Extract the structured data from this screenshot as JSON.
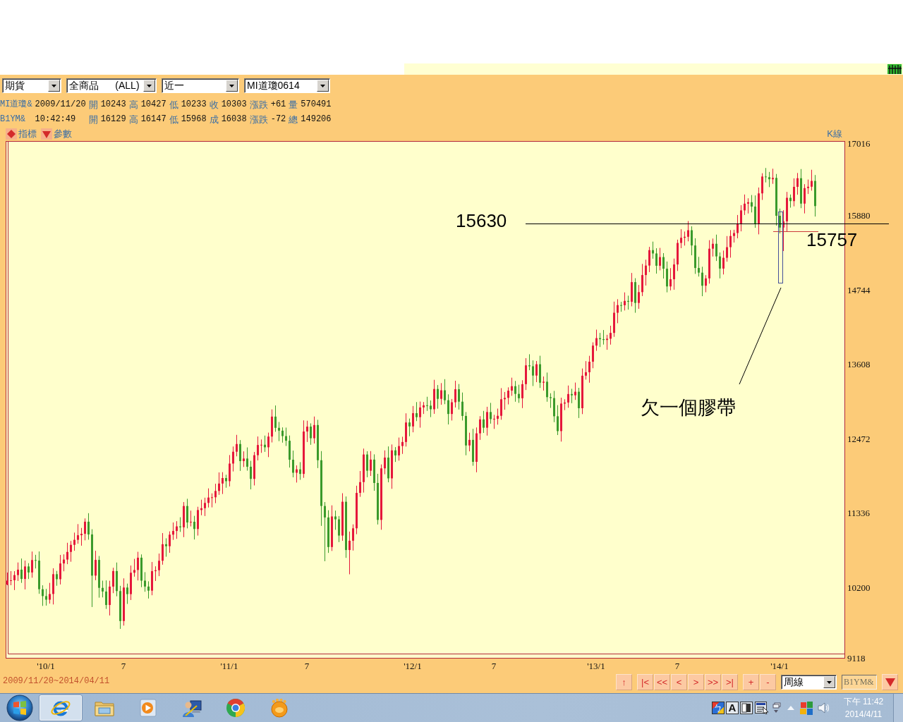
{
  "selectors": [
    {
      "value": "期貨"
    },
    {
      "value": "全商品      (ALL)"
    },
    {
      "value": "近一"
    },
    {
      "value": "MI道瓊0614"
    }
  ],
  "quotes": [
    {
      "symbol": "MI道瓊&",
      "stamp": "2009/11/20",
      "fields": [
        {
          "label": "開",
          "value": "10243"
        },
        {
          "label": "高",
          "value": "10427"
        },
        {
          "label": "低",
          "value": "10233"
        },
        {
          "label": "收",
          "value": "10303"
        },
        {
          "label": "漲跌",
          "value": "+61"
        },
        {
          "label": "量",
          "value": "570491"
        }
      ]
    },
    {
      "symbol": "B1YM&",
      "stamp": "10:42:49",
      "fields": [
        {
          "label": "開",
          "value": "16129"
        },
        {
          "label": "高",
          "value": "16147"
        },
        {
          "label": "低",
          "value": "15968"
        },
        {
          "label": "成",
          "value": "16038"
        },
        {
          "label": "漲跌",
          "value": "-72"
        },
        {
          "label": "總",
          "value": "149206"
        }
      ]
    }
  ],
  "chart_tools": [
    {
      "kind": "indicator",
      "label": "指標"
    },
    {
      "kind": "parameter",
      "label": "參數"
    }
  ],
  "chart": {
    "chart_data": {
      "type": "candlestick",
      "title": "K線",
      "ylim": [
        9118,
        17016
      ],
      "yticks": [
        17016,
        15880,
        14744,
        13608,
        12472,
        11336,
        10200,
        9118
      ],
      "categories": [
        null,
        null,
        null,
        null,
        null,
        null,
        null,
        null,
        null,
        null,
        null,
        "'10/1",
        null,
        null,
        null,
        null,
        null,
        null,
        null,
        null,
        null,
        null,
        null,
        null,
        null,
        null,
        null,
        null,
        null,
        null,
        null,
        null,
        null,
        "7",
        null,
        null,
        null,
        null,
        null,
        null,
        null,
        null,
        null,
        null,
        null,
        null,
        null,
        null,
        null,
        null,
        null,
        null,
        null,
        null,
        null,
        null,
        null,
        null,
        null,
        null,
        null,
        null,
        null,
        "'11/1",
        null,
        null,
        null,
        null,
        null,
        null,
        null,
        null,
        null,
        null,
        null,
        null,
        null,
        null,
        null,
        null,
        null,
        null,
        null,
        null,
        null,
        "7",
        null,
        null,
        null,
        null,
        null,
        null,
        null,
        null,
        null,
        null,
        null,
        null,
        null,
        null,
        null,
        null,
        null,
        null,
        null,
        null,
        null,
        null,
        null,
        null,
        null,
        null,
        null,
        null,
        null,
        "'12/1",
        null,
        null,
        null,
        null,
        null,
        null,
        null,
        null,
        null,
        null,
        null,
        null,
        null,
        null,
        null,
        null,
        null,
        null,
        null,
        null,
        null,
        null,
        "7",
        null,
        null,
        null,
        null,
        null,
        null,
        null,
        null,
        null,
        null,
        null,
        null,
        null,
        null,
        null,
        null,
        null,
        null,
        null,
        null,
        null,
        null,
        null,
        null,
        null,
        null,
        null,
        null,
        "'13/1",
        null,
        null,
        null,
        null,
        null,
        null,
        null,
        null,
        null,
        null,
        null,
        null,
        null,
        null,
        null,
        null,
        null,
        null,
        null,
        null,
        null,
        null,
        "7",
        null,
        null,
        null,
        null,
        null,
        null,
        null,
        null,
        null,
        null,
        null,
        null,
        null,
        null,
        null,
        null,
        null,
        null,
        null,
        null,
        null,
        null,
        null,
        null,
        null,
        null,
        null,
        null,
        "'14/1",
        null,
        null,
        null,
        null,
        null,
        null,
        null,
        null,
        null,
        null
      ],
      "ohlc": [
        [
          10243,
          10427,
          10233,
          10303
        ],
        [
          10303,
          10449,
          10233,
          10309
        ],
        [
          10309,
          10448,
          10159,
          10388
        ],
        [
          10388,
          10581,
          10298,
          10471
        ],
        [
          10471,
          10641,
          10269,
          10329
        ],
        [
          10329,
          10610,
          10169,
          10520
        ],
        [
          10520,
          10570,
          10328,
          10428
        ],
        [
          10428,
          10748,
          10348,
          10618
        ],
        [
          10618,
          10698,
          10489,
          10609
        ],
        [
          10609,
          10749,
          10102,
          10172
        ],
        [
          10172,
          10232,
          9917,
          10067
        ],
        [
          10067,
          10177,
          9922,
          10012
        ],
        [
          10012,
          10269,
          9952,
          10099
        ],
        [
          10099,
          10492,
          9939,
          10402
        ],
        [
          10402,
          10452,
          10225,
          10325
        ],
        [
          10325,
          10696,
          10245,
          10566
        ],
        [
          10566,
          10705,
          10446,
          10625
        ],
        [
          10625,
          10882,
          10555,
          10742
        ],
        [
          10742,
          10910,
          10592,
          10850
        ],
        [
          10850,
          11037,
          10760,
          10927
        ],
        [
          10927,
          11167,
          10867,
          10997
        ],
        [
          10997,
          11109,
          10837,
          11019
        ],
        [
          11019,
          11254,
          10919,
          11204
        ],
        [
          11204,
          11334,
          10929,
          11009
        ],
        [
          11009,
          11089,
          9900,
          10380
        ],
        [
          10380,
          10760,
          10310,
          10620
        ],
        [
          10620,
          10680,
          10043,
          10193
        ],
        [
          10193,
          10303,
          10047,
          10137
        ],
        [
          10137,
          10307,
          9871,
          9931
        ],
        [
          9931,
          10302,
          9771,
          10212
        ],
        [
          10212,
          10500,
          10112,
          10450
        ],
        [
          10450,
          10580,
          10064,
          10144
        ],
        [
          10144,
          10224,
          9566,
          9686
        ],
        [
          9686,
          10338,
          9616,
          10198
        ],
        [
          10198,
          10258,
          9947,
          10097
        ],
        [
          10097,
          10534,
          10007,
          10424
        ],
        [
          10424,
          10636,
          10364,
          10466
        ],
        [
          10466,
          10744,
          10306,
          10654
        ],
        [
          10654,
          10704,
          10203,
          10303
        ],
        [
          10303,
          10433,
          10133,
          10213
        ],
        [
          10213,
          10293,
          10030,
          10150
        ],
        [
          10150,
          10588,
          10080,
          10448
        ],
        [
          10448,
          10522,
          10298,
          10462
        ],
        [
          10462,
          10717,
          10372,
          10607
        ],
        [
          10607,
          11030,
          10547,
          10860
        ],
        [
          10860,
          10950,
          10669,
          10829
        ],
        [
          10829,
          11056,
          10729,
          11006
        ],
        [
          11006,
          11192,
          10926,
          11062
        ],
        [
          11062,
          11212,
          10942,
          11132
        ],
        [
          11132,
          11272,
          11048,
          11118
        ],
        [
          11118,
          11504,
          10968,
          11444
        ],
        [
          11444,
          11554,
          11102,
          11192
        ],
        [
          11192,
          11373,
          11132,
          11203
        ],
        [
          11203,
          11293,
          10932,
          11092
        ],
        [
          11092,
          11432,
          10992,
          11382
        ],
        [
          11382,
          11540,
          11302,
          11410
        ],
        [
          11410,
          11571,
          11290,
          11491
        ],
        [
          11491,
          11713,
          11421,
          11573
        ],
        [
          11573,
          11637,
          11423,
          11577
        ],
        [
          11577,
          11784,
          11487,
          11674
        ],
        [
          11674,
          11957,
          11614,
          11787
        ],
        [
          11787,
          11961,
          11627,
          11871
        ],
        [
          11871,
          11921,
          11723,
          11823
        ],
        [
          11823,
          12222,
          11743,
          12092
        ],
        [
          12092,
          12353,
          11972,
          12273
        ],
        [
          12273,
          12531,
          12203,
          12391
        ],
        [
          12391,
          12451,
          11980,
          12130
        ],
        [
          12130,
          12279,
          12040,
          12169
        ],
        [
          12169,
          12339,
          11984,
          12044
        ],
        [
          12044,
          12134,
          11698,
          11858
        ],
        [
          11858,
          12270,
          11758,
          12220
        ],
        [
          12220,
          12506,
          12140,
          12376
        ],
        [
          12376,
          12460,
          12256,
          12380
        ],
        [
          12380,
          12520,
          12271,
          12341
        ],
        [
          12341,
          12565,
          12191,
          12505
        ],
        [
          12505,
          12920,
          12415,
          12810
        ],
        [
          12810,
          12980,
          12578,
          12638
        ],
        [
          12638,
          12728,
          12435,
          12595
        ],
        [
          12595,
          12645,
          12412,
          12512
        ],
        [
          12512,
          12642,
          12361,
          12441
        ],
        [
          12441,
          12521,
          12031,
          12151
        ],
        [
          12151,
          12291,
          11882,
          11952
        ],
        [
          11952,
          12064,
          11802,
          12004
        ],
        [
          12004,
          12114,
          11844,
          11934
        ],
        [
          11934,
          12752,
          11874,
          12582
        ],
        [
          12582,
          12747,
          12422,
          12657
        ],
        [
          12657,
          12707,
          12379,
          12479
        ],
        [
          12479,
          12811,
          12399,
          12681
        ],
        [
          12681,
          12761,
          12023,
          12143
        ],
        [
          12143,
          12283,
          11140,
          11444
        ],
        [
          11444,
          11504,
          10600,
          11269
        ],
        [
          11269,
          11379,
          10727,
          10817
        ],
        [
          10817,
          11454,
          10757,
          11284
        ],
        [
          11284,
          11374,
          11080,
          11240
        ],
        [
          11240,
          11290,
          10892,
          10992
        ],
        [
          10992,
          11639,
          10912,
          11509
        ],
        [
          11509,
          11589,
          10651,
          10771
        ],
        [
          10771,
          11053,
          10400,
          10913
        ],
        [
          10913,
          11163,
          10763,
          11103
        ],
        [
          11103,
          11754,
          11013,
          11644
        ],
        [
          11644,
          11979,
          11584,
          11809
        ],
        [
          11809,
          12321,
          11649,
          12231
        ],
        [
          12231,
          12281,
          11883,
          11983
        ],
        [
          11983,
          12283,
          11903,
          12153
        ],
        [
          12153,
          12233,
          11676,
          11796
        ],
        [
          11796,
          11936,
          11161,
          11231
        ],
        [
          11231,
          12079,
          11081,
          12019
        ],
        [
          12019,
          12294,
          11929,
          12184
        ],
        [
          12184,
          12354,
          11806,
          11866
        ],
        [
          11866,
          12384,
          11706,
          12294
        ],
        [
          12294,
          12344,
          12117,
          12217
        ],
        [
          12217,
          12490,
          12137,
          12360
        ],
        [
          12360,
          12502,
          12240,
          12422
        ],
        [
          12422,
          12860,
          12352,
          12720
        ],
        [
          12720,
          12780,
          12510,
          12660
        ],
        [
          12660,
          12972,
          12570,
          12862
        ],
        [
          12862,
          13032,
          12741,
          12801
        ],
        [
          12801,
          13040,
          12641,
          12950
        ],
        [
          12950,
          13033,
          12850,
          12983
        ],
        [
          12983,
          13113,
          12897,
          12977
        ],
        [
          12977,
          13057,
          12802,
          12922
        ],
        [
          12922,
          13372,
          12852,
          13232
        ],
        [
          13232,
          13292,
          12931,
          13081
        ],
        [
          13081,
          13322,
          12991,
          13212
        ],
        [
          13212,
          13382,
          13000,
          13060
        ],
        [
          13060,
          13150,
          12690,
          12850
        ],
        [
          12850,
          13079,
          12750,
          13029
        ],
        [
          13029,
          13358,
          12949,
          13228
        ],
        [
          13228,
          13308,
          12918,
          13038
        ],
        [
          13038,
          13178,
          12750,
          12820
        ],
        [
          12820,
          12880,
          12219,
          12369
        ],
        [
          12369,
          12564,
          12279,
          12454
        ],
        [
          12454,
          12624,
          12059,
          12119
        ],
        [
          12119,
          12644,
          11959,
          12554
        ],
        [
          12554,
          12817,
          12454,
          12767
        ],
        [
          12767,
          12897,
          12560,
          12640
        ],
        [
          12640,
          12960,
          12520,
          12880
        ],
        [
          12880,
          13020,
          12702,
          12772
        ],
        [
          12772,
          12837,
          12622,
          12777
        ],
        [
          12777,
          12932,
          12687,
          12822
        ],
        [
          12822,
          13245,
          12762,
          13075
        ],
        [
          13075,
          13186,
          12915,
          13096
        ],
        [
          13096,
          13257,
          12996,
          13207
        ],
        [
          13207,
          13405,
          13127,
          13275
        ],
        [
          13275,
          13355,
          13037,
          13157
        ],
        [
          13157,
          13297,
          13020,
          13090
        ],
        [
          13090,
          13366,
          12940,
          13306
        ],
        [
          13306,
          13703,
          13216,
          13593
        ],
        [
          13593,
          13763,
          13519,
          13579
        ],
        [
          13579,
          13669,
          13277,
          13437
        ],
        [
          13437,
          13660,
          13337,
          13610
        ],
        [
          13610,
          13740,
          13248,
          13328
        ],
        [
          13328,
          13423,
          13208,
          13343
        ],
        [
          13343,
          13483,
          13037,
          13107
        ],
        [
          13107,
          13167,
          12943,
          13093
        ],
        [
          13093,
          13203,
          12725,
          12815
        ],
        [
          12815,
          12985,
          12528,
          12588
        ],
        [
          12588,
          13099,
          12428,
          13009
        ],
        [
          13009,
          13075,
          12909,
          13025
        ],
        [
          13025,
          13285,
          12945,
          13155
        ],
        [
          13155,
          13235,
          13015,
          13135
        ],
        [
          13135,
          13330,
          13065,
          13190
        ],
        [
          13190,
          13250,
          12788,
          12938
        ],
        [
          12938,
          13545,
          12848,
          13435
        ],
        [
          13435,
          13658,
          13375,
          13488
        ],
        [
          13488,
          13739,
          13328,
          13649
        ],
        [
          13649,
          13945,
          13549,
          13895
        ],
        [
          13895,
          14139,
          13815,
          14009
        ],
        [
          14009,
          14089,
          13873,
          13993
        ],
        [
          13993,
          14133,
          13911,
          13981
        ],
        [
          13981,
          14060,
          13831,
          14000
        ],
        [
          14000,
          14199,
          13910,
          14089
        ],
        [
          14089,
          14567,
          14029,
          14397
        ],
        [
          14397,
          14604,
          14237,
          14514
        ],
        [
          14514,
          14564,
          14412,
          14512
        ],
        [
          14512,
          14708,
          14432,
          14578
        ],
        [
          14578,
          14658,
          14445,
          14565
        ],
        [
          14565,
          15005,
          14495,
          14865
        ],
        [
          14865,
          14925,
          14397,
          14547
        ],
        [
          14547,
          14822,
          14457,
          14712
        ],
        [
          14712,
          15143,
          14652,
          14973
        ],
        [
          14973,
          15208,
          14813,
          15118
        ],
        [
          15118,
          15404,
          15018,
          15354
        ],
        [
          15354,
          15484,
          15223,
          15303
        ],
        [
          15303,
          15383,
          14995,
          15115
        ],
        [
          15115,
          15388,
          15045,
          15248
        ],
        [
          15248,
          15308,
          14920,
          15070
        ],
        [
          15070,
          15180,
          14709,
          14799
        ],
        [
          14799,
          15079,
          14739,
          14909
        ],
        [
          14909,
          15225,
          14749,
          15135
        ],
        [
          15135,
          15514,
          15035,
          15464
        ],
        [
          15464,
          15673,
          15384,
          15543
        ],
        [
          15543,
          15638,
          15423,
          15558
        ],
        [
          15558,
          15798,
          15488,
          15658
        ],
        [
          15658,
          15718,
          15275,
          15425
        ],
        [
          15425,
          15535,
          14991,
          15081
        ],
        [
          15081,
          15251,
          14950,
          15010
        ],
        [
          15010,
          15100,
          14650,
          14810
        ],
        [
          14810,
          14972,
          14710,
          14922
        ],
        [
          14922,
          15506,
          14842,
          15376
        ],
        [
          15376,
          15531,
          15256,
          15451
        ],
        [
          15451,
          15591,
          15188,
          15258
        ],
        [
          15258,
          15318,
          14922,
          15072
        ],
        [
          15072,
          15347,
          14982,
          15237
        ],
        [
          15237,
          15569,
          15177,
          15399
        ],
        [
          15399,
          15660,
          15239,
          15570
        ],
        [
          15570,
          15665,
          15470,
          15615
        ],
        [
          15615,
          15891,
          15535,
          15761
        ],
        [
          15761,
          16041,
          15641,
          15961
        ],
        [
          15961,
          16204,
          15891,
          16064
        ],
        [
          16064,
          16146,
          15914,
          16086
        ],
        [
          16086,
          16196,
          15930,
          16020
        ],
        [
          16020,
          16190,
          15695,
          15755
        ],
        [
          15755,
          16311,
          15595,
          16221
        ],
        [
          16221,
          16529,
          16121,
          16479
        ],
        [
          16479,
          16609,
          16389,
          16469
        ],
        [
          16469,
          16549,
          16317,
          16437
        ],
        [
          16437,
          16598,
          16367,
          16458
        ],
        [
          16458,
          16518,
          15729,
          15879
        ],
        [
          15879,
          15989,
          15609,
          15699
        ],
        [
          15699,
          15964,
          15340,
          15794
        ],
        [
          15794,
          16244,
          15634,
          16154
        ],
        [
          16154,
          16204,
          16003,
          16103
        ],
        [
          16103,
          16451,
          16023,
          16321
        ],
        [
          16321,
          16533,
          16201,
          16453
        ],
        [
          16453,
          16593,
          15995,
          16065
        ],
        [
          16065,
          16362,
          15915,
          16302
        ],
        [
          16302,
          16433,
          16212,
          16323
        ],
        [
          16323,
          16582,
          16263,
          16412
        ],
        [
          16412,
          16502,
          15867,
          16027
        ]
      ]
    },
    "annotations": [
      "15630",
      "15757",
      "欠一個膠帶"
    ]
  },
  "bottom_bar": {
    "date_range": "2009/11/20~2014/04/11",
    "button_groups": [
      [
        "↑"
      ],
      [
        "|<",
        "<<",
        "<",
        ">",
        ">>",
        ">|"
      ],
      [
        "+",
        "-"
      ]
    ],
    "period_select": {
      "value": "周線"
    },
    "symbol_field": {
      "value": "B1YM&",
      "disabled": true
    }
  },
  "taskbar": {
    "apps": [
      {
        "selected": true
      },
      {
        "selected": false
      },
      {
        "selected": false
      },
      {
        "selected": false
      },
      {
        "selected": false
      },
      {
        "selected": false
      }
    ],
    "input_indicators": [
      "ㄅ",
      "A"
    ],
    "clock": {
      "time": "下午 11:42",
      "date": "2014/4/11"
    }
  }
}
